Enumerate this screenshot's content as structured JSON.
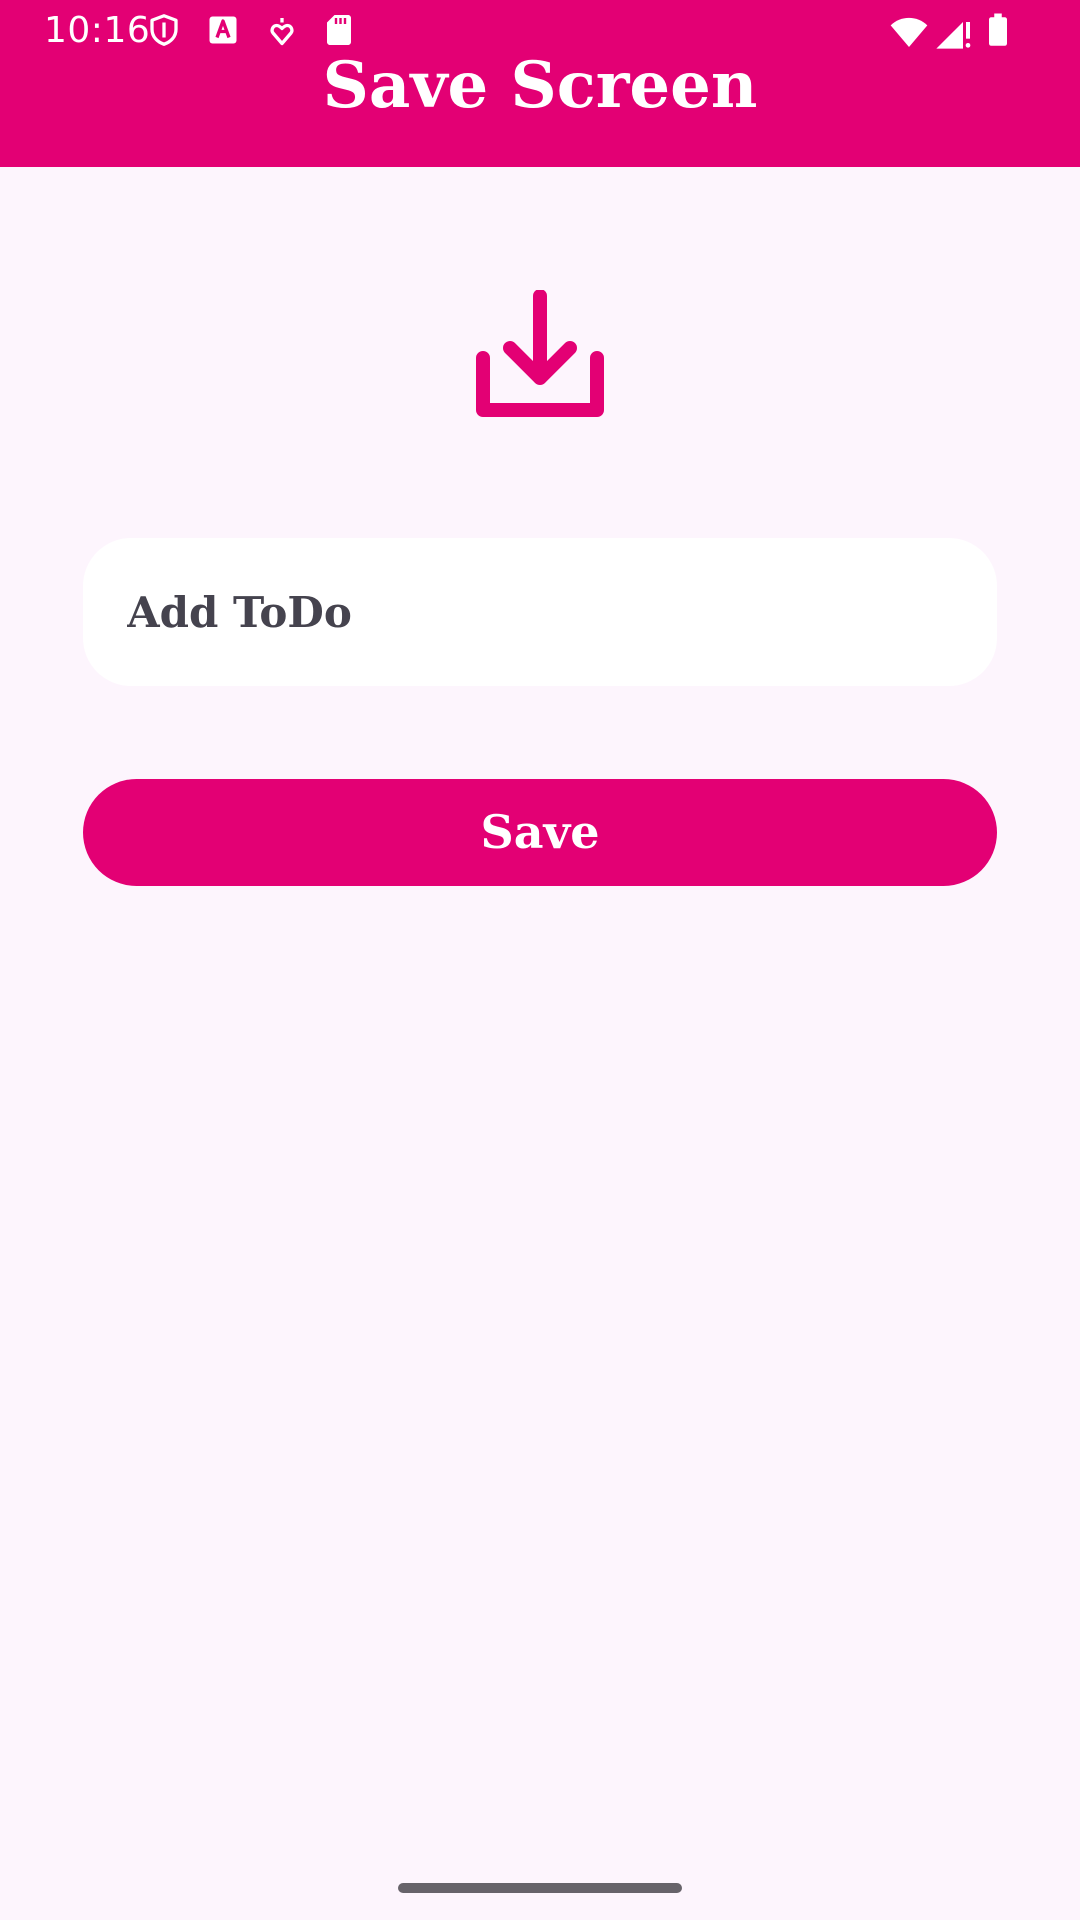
{
  "status_bar": {
    "time": "10:16",
    "icons": [
      "shield-icon",
      "font-a-icon",
      "location-heart-icon",
      "sd-card-icon",
      "wifi-icon",
      "signal-alert-icon",
      "battery-icon"
    ]
  },
  "app_bar": {
    "title": "Save Screen"
  },
  "hero": {
    "icon": "download-tray-icon"
  },
  "todo_input": {
    "placeholder": "Add ToDo",
    "value": ""
  },
  "save_button": {
    "label": "Save"
  },
  "colors": {
    "primary": "#E30074",
    "background": "#FDF5FD",
    "field_background": "#FFFFFF",
    "field_text": "#45434E",
    "nav_handle": "#67636A"
  }
}
